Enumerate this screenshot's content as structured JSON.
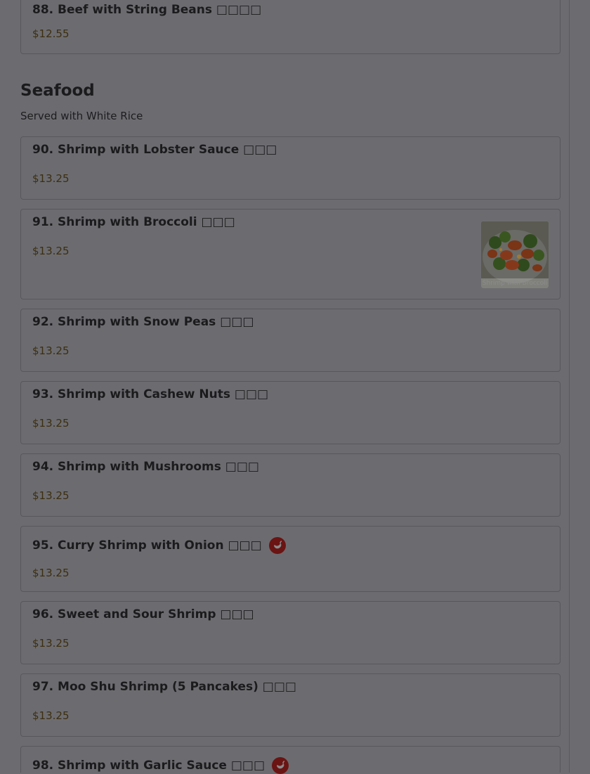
{
  "items_top": [
    {
      "name": "88. Beef with String Beans □□□□",
      "price": "$12.55"
    }
  ],
  "section": {
    "title": "Seafood",
    "description": "Served with White Rice"
  },
  "items": [
    {
      "name": "90. Shrimp with Lobster Sauce □□□",
      "price": "$13.25"
    },
    {
      "name": "91. Shrimp with Broccoli □□□",
      "price": "$13.25",
      "photo_caption": "Shrimp with Broccoli"
    },
    {
      "name": "92. Shrimp with Snow Peas □□□",
      "price": "$13.25"
    },
    {
      "name": "93. Shrimp with Cashew Nuts □□□",
      "price": "$13.25"
    },
    {
      "name": "94. Shrimp with Mushrooms □□□",
      "price": "$13.25"
    },
    {
      "name": "95. Curry Shrimp with Onion □□□",
      "price": "$13.25",
      "spicy": true
    },
    {
      "name": "96. Sweet and Sour Shrimp □□□",
      "price": "$13.25"
    },
    {
      "name": "97. Moo Shu Shrimp (5 Pancakes) □□□",
      "price": "$13.25"
    },
    {
      "name": "98. Shrimp with Garlic Sauce □□□",
      "price": "",
      "spicy": true
    }
  ],
  "icons": {
    "spicy": "chili-pepper-icon"
  },
  "colors": {
    "overlay": "#6c6c70",
    "price": "#3c2e10",
    "spicy_badge": "#6a1414"
  }
}
